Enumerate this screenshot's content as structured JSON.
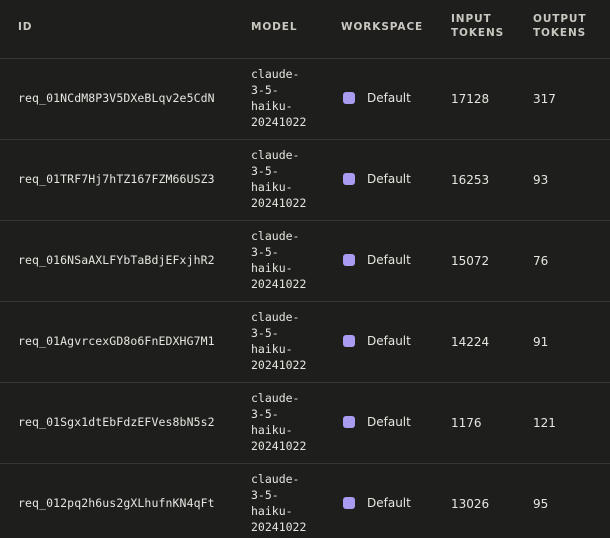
{
  "columns": {
    "id": "ID",
    "model": "MODEL",
    "workspace": "WORKSPACE",
    "input_tokens": "INPUT TOKENS",
    "output_tokens": "OUTPUT TOKENS"
  },
  "colors": {
    "background": "#1e1e1c",
    "workspace_dot": "#a99cf0",
    "divider": "#363633"
  },
  "rows": [
    {
      "id": "req_01NCdM8P3V5DXeBLqv2e5CdN",
      "model": "claude-\n3-5-\nhaiku-\n20241022",
      "workspace": "Default",
      "input_tokens": "17128",
      "output_tokens": "317"
    },
    {
      "id": "req_01TRF7Hj7hTZ167FZM66USZ3",
      "model": "claude-\n3-5-\nhaiku-\n20241022",
      "workspace": "Default",
      "input_tokens": "16253",
      "output_tokens": "93"
    },
    {
      "id": "req_016NSaAXLFYbTaBdjEFxjhR2",
      "model": "claude-\n3-5-\nhaiku-\n20241022",
      "workspace": "Default",
      "input_tokens": "15072",
      "output_tokens": "76"
    },
    {
      "id": "req_01AgvrcexGD8o6FnEDXHG7M1",
      "model": "claude-\n3-5-\nhaiku-\n20241022",
      "workspace": "Default",
      "input_tokens": "14224",
      "output_tokens": "91"
    },
    {
      "id": "req_01Sgx1dtEbFdzEFVes8bN5s2",
      "model": "claude-\n3-5-\nhaiku-\n20241022",
      "workspace": "Default",
      "input_tokens": "1176",
      "output_tokens": "121"
    },
    {
      "id": "req_012pq2h6us2gXLhufnKN4qFt",
      "model": "claude-\n3-5-\nhaiku-\n20241022",
      "workspace": "Default",
      "input_tokens": "13026",
      "output_tokens": "95"
    }
  ]
}
